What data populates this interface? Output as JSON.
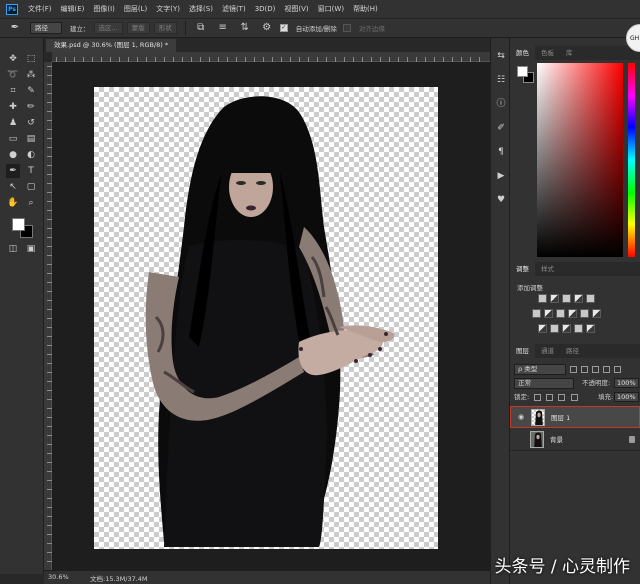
{
  "app": {
    "logo_text": "Ps"
  },
  "menu": [
    "文件(F)",
    "编辑(E)",
    "图像(I)",
    "图层(L)",
    "文字(Y)",
    "选择(S)",
    "滤镜(T)",
    "3D(D)",
    "视图(V)",
    "窗口(W)",
    "帮助(H)"
  ],
  "options_bar": {
    "mode_select": "路径",
    "build_label": "建立：",
    "selection_btn": "选区...",
    "mask_btn": "蒙版",
    "shape_btn": "形状",
    "auto_add_delete_label": "自动添加/删除",
    "align_edges_label": "对齐边缘"
  },
  "document": {
    "tab_title": "效果.psd @ 30.6% (图层 1, RGB/8) *",
    "zoom": "30.6%",
    "doc_info": "文档:15.3M/37.4M"
  },
  "panels": {
    "color_tabs": [
      "颜色",
      "色板",
      "库"
    ],
    "adjust_tabs": [
      "调整",
      "样式"
    ],
    "adjust_title": "添加调整",
    "layers_tabs": [
      "图层",
      "通道",
      "路径"
    ],
    "kind_filter": "ρ 类型",
    "blend_mode": "正常",
    "opacity_label": "不透明度:",
    "opacity_value": "100%",
    "lock_label": "锁定:",
    "fill_label": "填充:",
    "fill_value": "100%",
    "layers": [
      {
        "name": "图层 1",
        "selected": true,
        "visible": true
      },
      {
        "name": "背景",
        "selected": false,
        "visible": false
      }
    ]
  },
  "foreground_color": "#ffffff",
  "background_color": "#000000",
  "watermark": "头条号 / 心灵制作",
  "avatar_text": "GH"
}
